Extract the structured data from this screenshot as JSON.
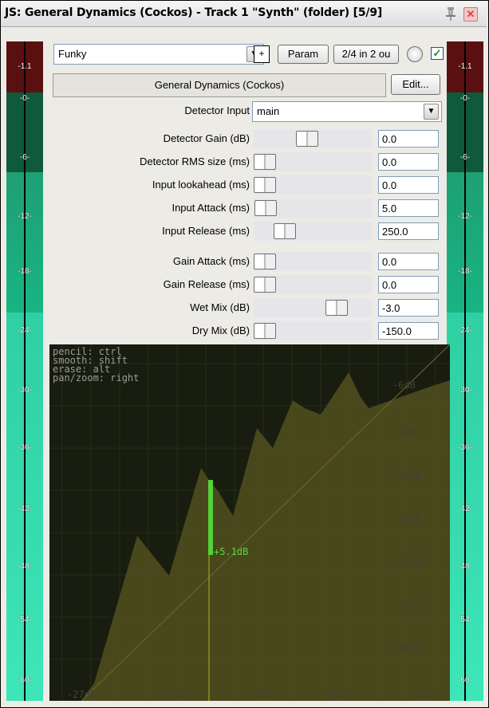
{
  "window": {
    "title": "JS: General Dynamics (Cockos) - Track 1 \"Synth\" (folder) [5/9]",
    "pin_icon": "pin-icon",
    "close_icon": "close-icon"
  },
  "toolbar": {
    "preset": "Funky",
    "plus_label": "+",
    "param_label": "Param",
    "io_label": "2/4 in 2 ou",
    "bypass_checked": true
  },
  "plugin": {
    "name": "General Dynamics (Cockos)",
    "edit_label": "Edit...",
    "detector_input_label": "Detector Input",
    "detector_input_value": "main"
  },
  "params": [
    {
      "label": "Detector Gain (dB)",
      "value": "0.0",
      "position": 0.44
    },
    {
      "label": "Detector RMS size (ms)",
      "value": "0.0",
      "position": 0.0
    },
    {
      "label": "Input lookahead (ms)",
      "value": "0.0",
      "position": 0.0
    },
    {
      "label": "Input Attack (ms)",
      "value": "5.0",
      "position": 0.01
    },
    {
      "label": "Input Release (ms)",
      "value": "250.0",
      "position": 0.21
    },
    {
      "label": "Gain Attack (ms)",
      "value": "0.0",
      "position": 0.0
    },
    {
      "label": "Gain Release (ms)",
      "value": "0.0",
      "position": 0.0
    },
    {
      "label": "Wet Mix (dB)",
      "value": "-3.0",
      "position": 0.75
    },
    {
      "label": "Dry Mix (dB)",
      "value": "-150.0",
      "position": 0.0
    }
  ],
  "meters": {
    "left_peak": "-1.1",
    "right_peak": "-1.1",
    "scale": [
      "-0-",
      "-6-",
      "-12-",
      "-18-",
      "-24-",
      "-30-",
      "-36-",
      "-42-",
      "-48-",
      "-54-",
      "-60-"
    ]
  },
  "graph": {
    "hints": [
      "pencil: ctrl",
      "smooth: shift",
      "erase: alt",
      "pan/zoom: right"
    ],
    "y_labels": [
      "-6dB",
      "-9dB",
      "-12dB",
      "-15dB",
      "-18dB",
      "-21dB",
      "-24dB"
    ],
    "x_labels": [
      "-27dB",
      "-21dB",
      "-15dB",
      "-9dB",
      "+0dB"
    ],
    "gain_readout": "+5.1dB"
  }
}
